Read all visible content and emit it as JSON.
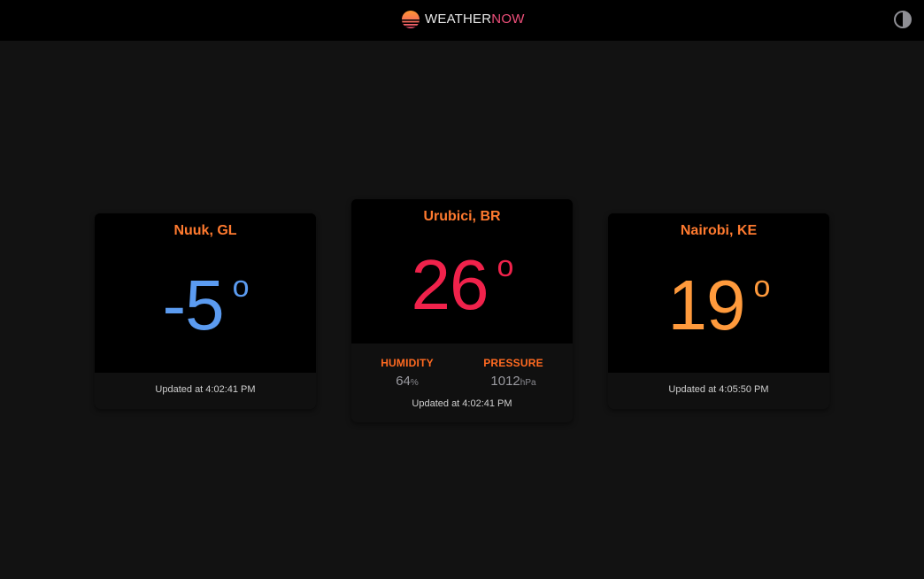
{
  "header": {
    "brand_part1": "WEATHER",
    "brand_part2": "NOW",
    "brand_color_1": "#e8e8e8",
    "brand_color_2": "#ee4f7a",
    "logo_icon": "sunset-logo-icon",
    "theme_toggle_icon": "contrast-toggle-icon"
  },
  "cards": [
    {
      "city": "Nuuk, GL",
      "temperature": "-5",
      "degree_symbol": "o",
      "temp_color": "#5b9bf0",
      "updated": "Updated at 4:02:41 PM"
    },
    {
      "city": "Urubici, BR",
      "temperature": "26",
      "degree_symbol": "o",
      "temp_color": "#f0224b",
      "humidity_label": "HUMIDITY",
      "humidity_value": "64",
      "humidity_unit": "%",
      "pressure_label": "PRESSURE",
      "pressure_value": "1012",
      "pressure_unit": "hPa",
      "updated": "Updated at 4:02:41 PM"
    },
    {
      "city": "Nairobi, KE",
      "temperature": "19",
      "degree_symbol": "o",
      "temp_color": "#ff9a3c",
      "updated": "Updated at 4:05:50 PM"
    }
  ],
  "colors": {
    "accent": "#ff7a2f",
    "background": "#121212"
  }
}
